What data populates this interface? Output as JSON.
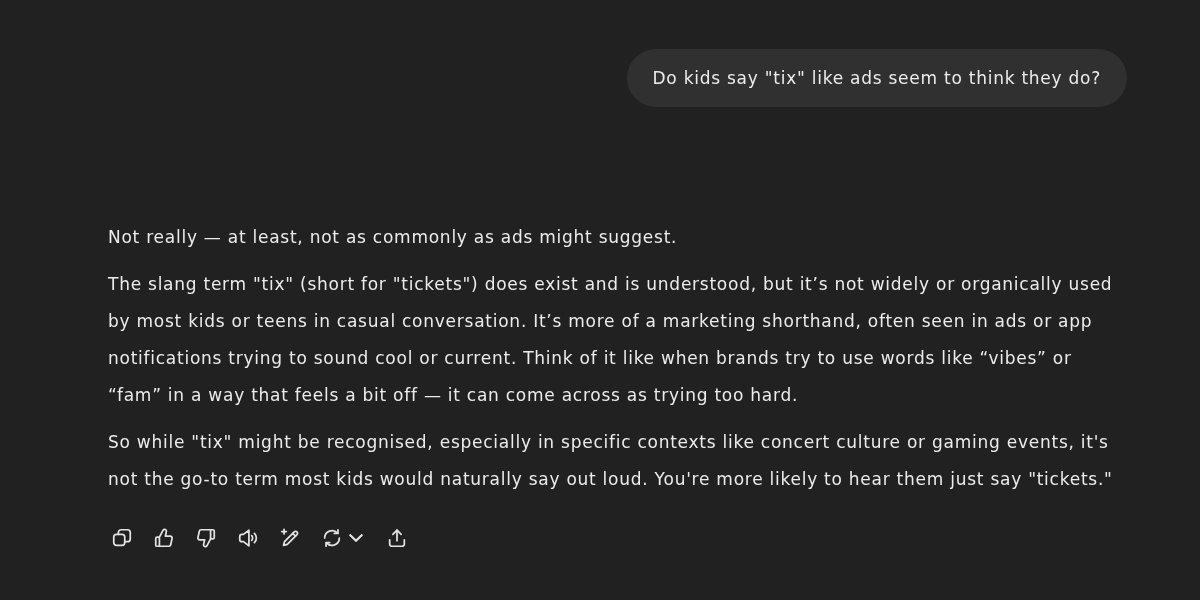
{
  "user_message": {
    "text": "Do kids say \"tix\" like ads seem to think they do?"
  },
  "response": {
    "paragraphs": [
      "Not really — at least, not as commonly as ads might suggest.",
      "The slang term \"tix\" (short for \"tickets\") does exist and is understood, but it’s not widely or organically used by most kids or teens in casual conversation. It’s more of a marketing shorthand, often seen in ads or app notifications trying to sound cool or current. Think of it like when brands try to use words like “vibes” or “fam” in a way that feels a bit off — it can come across as trying too hard.",
      "So while \"tix\" might be recognised, especially in specific contexts like concert culture or gaming events, it's not the go-to term most kids would naturally say out loud. You're more likely to hear them just say \"tickets.\""
    ]
  }
}
